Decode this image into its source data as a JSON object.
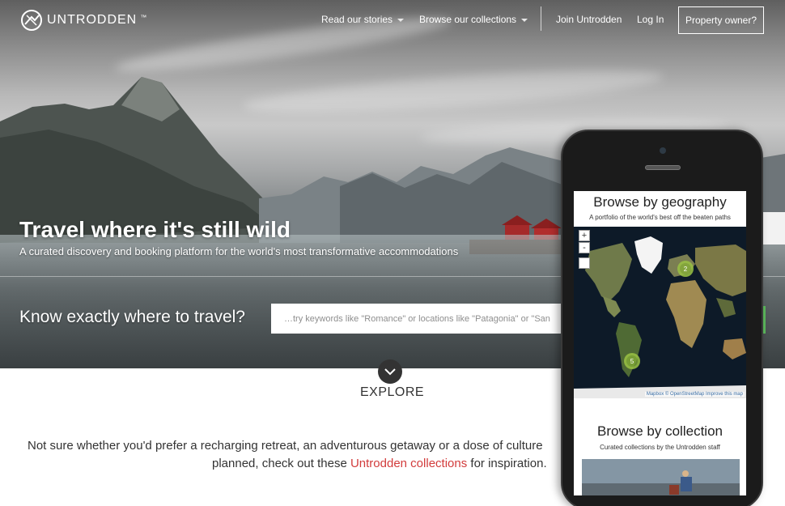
{
  "nav": {
    "brand": "UNTRODDEN",
    "brand_tm": "™",
    "links": [
      {
        "label": "Read our stories",
        "has_dropdown": true
      },
      {
        "label": "Browse our collections",
        "has_dropdown": true
      },
      {
        "label": "Join Untrodden",
        "has_dropdown": false
      },
      {
        "label": "Log In",
        "has_dropdown": false
      }
    ],
    "owner_button": "Property owner?"
  },
  "hero": {
    "title": "Travel where it's still wild",
    "subtitle": "A curated discovery and booking platform for the world's most transformative accommodations",
    "search_prompt": "Know exactly where to travel?",
    "search_placeholder": "…try keywords like \"Romance\" or locations like \"Patagonia\" or \"San"
  },
  "explore": {
    "label": "EXPLORE",
    "icon": "chevron-down-icon"
  },
  "intro": {
    "line1": "Not sure whether you'd prefer a recharging retreat, an adventurous getaway or a dose of culture",
    "line2_prefix": "planned, check out these ",
    "line2_link": "Untrodden collections",
    "line2_suffix": " for inspiration."
  },
  "phone": {
    "geo_title": "Browse by geography",
    "geo_subtitle": "A portfolio of the world's best off the beaten paths",
    "zoom_in": "+",
    "zoom_out": "-",
    "clusters": [
      "2",
      "5"
    ],
    "map_attribution": "Mapbox © OpenStreetMap Improve this map",
    "collection_title": "Browse by collection",
    "collection_subtitle": "Curated collections by the Untrodden staff"
  },
  "colors": {
    "accent_red": "#d23c3c",
    "cluster_green": "#86b037",
    "text_dark": "#333333"
  }
}
